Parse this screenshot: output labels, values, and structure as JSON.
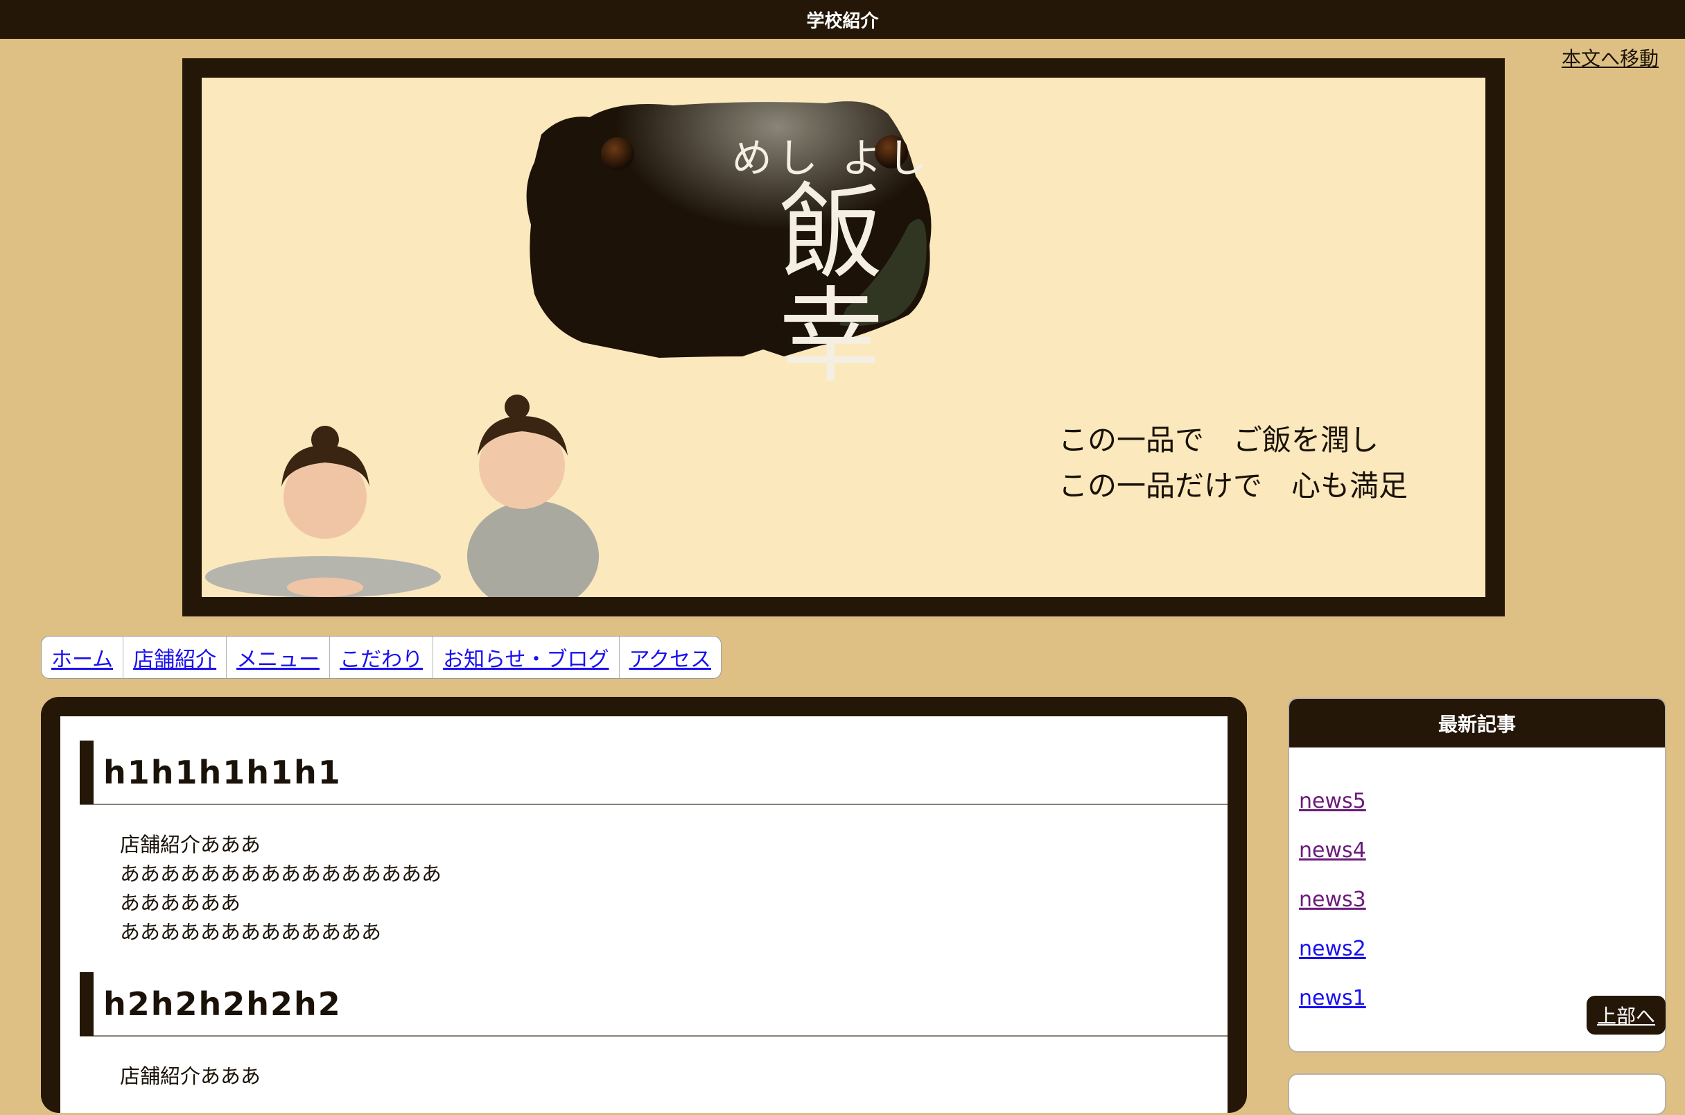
{
  "window": {
    "title": "学校紹介"
  },
  "skip_link": "本文へ移動",
  "banner": {
    "sign_ruby": "めし よし",
    "sign_title": "飯幸",
    "tagline_line1": "この一品で　ご飯を潤し",
    "tagline_line2": "この一品だけで　心も満足"
  },
  "nav": {
    "items": [
      {
        "label": "ホーム"
      },
      {
        "label": "店舗紹介"
      },
      {
        "label": "メニュー"
      },
      {
        "label": "こだわり"
      },
      {
        "label": "お知らせ・ブログ"
      },
      {
        "label": "アクセス"
      }
    ]
  },
  "main": {
    "sections": [
      {
        "heading": "h1h1h1h1h1",
        "lines": [
          "店舗紹介あああ",
          "ああああああああああああああああ",
          "ああああああ",
          "あああああああああああああ"
        ]
      },
      {
        "heading": "h2h2h2h2h2",
        "lines": [
          "店舗紹介あああ"
        ]
      }
    ]
  },
  "sidebar": {
    "title": "最新記事",
    "news": [
      {
        "label": "news5",
        "visited": true
      },
      {
        "label": "news4",
        "visited": true
      },
      {
        "label": "news3",
        "visited": true
      },
      {
        "label": "news2",
        "visited": false
      },
      {
        "label": "news1",
        "visited": false
      }
    ]
  },
  "to_top_label": "上部へ",
  "colors": {
    "page_bg": "#dfc084",
    "dark_brown": "#251708",
    "banner_bg": "#fbe8bd",
    "link_blue": "#1a0ff0",
    "link_visited": "#6b1a7a"
  }
}
